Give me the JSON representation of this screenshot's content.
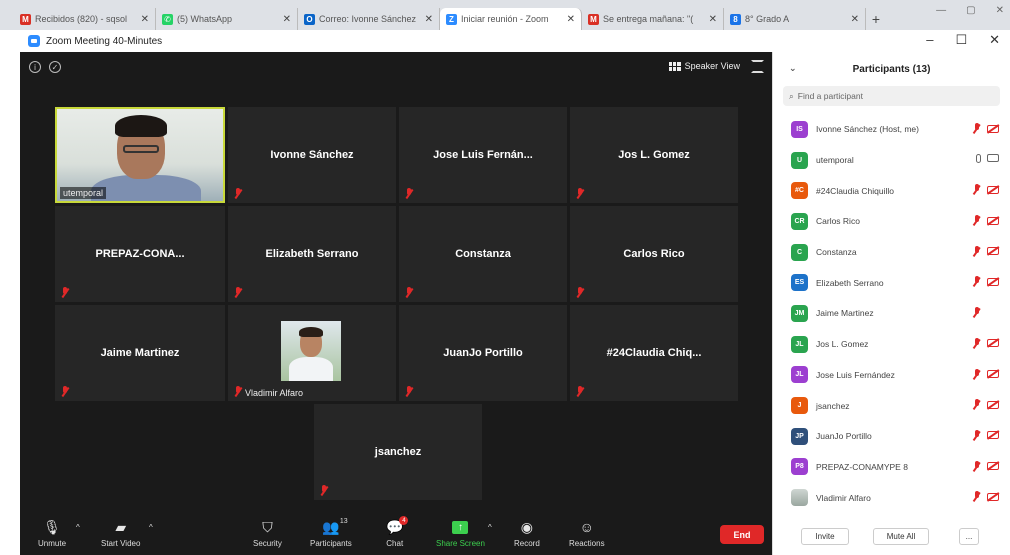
{
  "browser": {
    "tabs": [
      {
        "title": "Recibidos (820) - sqsol",
        "icon": "gmail-icon",
        "color": "#d93025",
        "glyph": "M",
        "active": false
      },
      {
        "title": "(5) WhatsApp",
        "icon": "whatsapp-icon",
        "color": "#25d366",
        "glyph": "✆",
        "active": false
      },
      {
        "title": "Correo: Ivonne Sánchez",
        "icon": "outlook-icon",
        "color": "#0a64c8",
        "glyph": "O",
        "active": false
      },
      {
        "title": "Iniciar reunión - Zoom",
        "icon": "zoom-icon",
        "color": "#2d8cff",
        "glyph": "Z",
        "active": true
      },
      {
        "title": "Se entrega mañana: \"(",
        "icon": "gmail-icon",
        "color": "#d93025",
        "glyph": "M",
        "active": false
      },
      {
        "title": "8° Grado A",
        "icon": "classroom-icon",
        "color": "#1a73e8",
        "glyph": "8",
        "active": false
      }
    ]
  },
  "window": {
    "title": "Zoom Meeting 40-Minutes"
  },
  "meeting": {
    "speaker_view_label": "Speaker View",
    "tiles": [
      {
        "name": "utemporal",
        "video": true
      },
      {
        "name": "Ivonne Sánchez"
      },
      {
        "name": "Jose Luis Fernán..."
      },
      {
        "name": "Jos  L. Gomez"
      },
      {
        "name": "PREPAZ-CONA..."
      },
      {
        "name": "Elizabeth Serrano"
      },
      {
        "name": "Constanza"
      },
      {
        "name": "Carlos Rico"
      },
      {
        "name": "Jaime Martinez"
      },
      {
        "name": "Vladimir Alfaro",
        "video": true
      },
      {
        "name": "JuanJo Portillo"
      },
      {
        "name": "#24Claudia  Chiq..."
      },
      {
        "name": "jsanchez"
      }
    ]
  },
  "toolbar": {
    "unmute": "Unmute",
    "start_video": "Start Video",
    "security": "Security",
    "participants": "Participants",
    "participants_count": "13",
    "chat": "Chat",
    "chat_badge": "4",
    "share_screen": "Share Screen",
    "record": "Record",
    "reactions": "Reactions",
    "end": "End"
  },
  "panel": {
    "title": "Participants (13)",
    "search_placeholder": "Find a participant",
    "participants": [
      {
        "initials": "IS",
        "name": "Ivonne Sánchez (Host, me)",
        "color": "#9c3fd0",
        "mic": "off",
        "video": "off"
      },
      {
        "initials": "U",
        "name": "utemporal",
        "color": "#2aa44f",
        "mic": "on",
        "video": "on"
      },
      {
        "initials": "#C",
        "name": "#24Claudia Chiquillo",
        "color": "#e8590c",
        "mic": "off",
        "video": "off"
      },
      {
        "initials": "CR",
        "name": "Carlos Rico",
        "color": "#2aa44f",
        "mic": "off",
        "video": "off"
      },
      {
        "initials": "C",
        "name": "Constanza",
        "color": "#2aa44f",
        "mic": "off",
        "video": "off"
      },
      {
        "initials": "ES",
        "name": "Elizabeth Serrano",
        "color": "#1d72c9",
        "mic": "off",
        "video": "off"
      },
      {
        "initials": "JM",
        "name": "Jaime Martinez",
        "color": "#2aa44f",
        "mic": "off",
        "video": "none"
      },
      {
        "initials": "JL",
        "name": "Jos  L. Gomez",
        "color": "#2aa44f",
        "mic": "off",
        "video": "off"
      },
      {
        "initials": "JL",
        "name": "Jose Luis Fernández",
        "color": "#9c3fd0",
        "mic": "off",
        "video": "off"
      },
      {
        "initials": "J",
        "name": "jsanchez",
        "color": "#e8590c",
        "mic": "off",
        "video": "off"
      },
      {
        "initials": "JP",
        "name": "JuanJo Portillo",
        "color": "#2f4f7a",
        "mic": "off",
        "video": "off"
      },
      {
        "initials": "P8",
        "name": "PREPAZ-CONAMYPE 8",
        "color": "#9c3fd0",
        "mic": "off",
        "video": "off"
      },
      {
        "initials": "",
        "name": "Vladimir Alfaro",
        "color": "#9aa7a0",
        "photo": true,
        "mic": "off",
        "video": "off"
      }
    ],
    "invite": "Invite",
    "mute_all": "Mute All",
    "more": "..."
  }
}
